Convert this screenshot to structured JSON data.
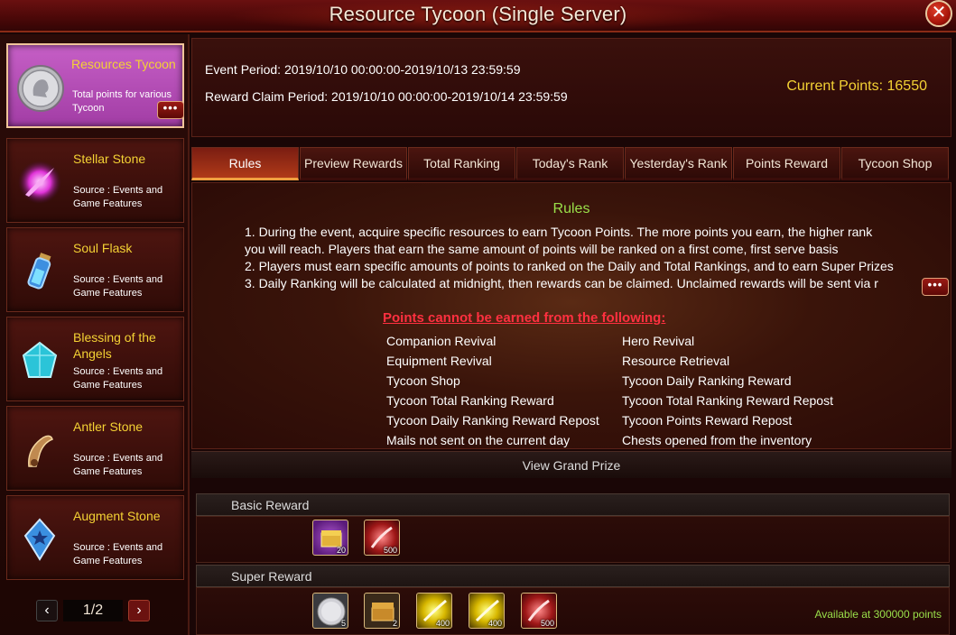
{
  "window": {
    "title": "Resource Tycoon (Single Server)"
  },
  "sidebar": {
    "items": [
      {
        "title": "Resources Tycoon",
        "desc": "Total points for various Tycoon",
        "icon": "silver-coin-icon",
        "active": true
      },
      {
        "title": "Stellar Stone",
        "desc": "Source : Events and Game Features",
        "icon": "stellar-stone-icon"
      },
      {
        "title": "Soul Flask",
        "desc": "Source : Events and Game Features",
        "icon": "soul-flask-icon"
      },
      {
        "title": "Blessing of the Angels",
        "desc": "Source : Events and Game Features",
        "icon": "cyan-crystal-icon"
      },
      {
        "title": "Antler Stone",
        "desc": "Source : Events and Game Features",
        "icon": "antler-stone-icon"
      },
      {
        "title": "Augment Stone",
        "desc": "Source : Events and Game Features",
        "icon": "augment-stone-icon"
      }
    ],
    "more_label": "•••",
    "pager": {
      "prev": "‹",
      "page": "1/2",
      "next": "›"
    }
  },
  "info": {
    "event_period": "Event Period: 2019/10/10 00:00:00-2019/10/13 23:59:59",
    "claim_period": "Reward Claim Period: 2019/10/10 00:00:00-2019/10/14 23:59:59",
    "current_points": "Current Points: 16550"
  },
  "tabs": [
    "Rules",
    "Preview Rewards",
    "Total Ranking",
    "Today's Rank",
    "Yesterday's Rank",
    "Points Reward",
    "Tycoon Shop"
  ],
  "rules": {
    "heading": "Rules",
    "lines": [
      "1. During the event, acquire specific resources to earn Tycoon Points. The more points you earn, the higher rank",
      "you will reach. Players that earn the same amount of points will be ranked on a first come, first serve basis",
      "2. Players must earn specific amounts of points to ranked on the Daily and Total Rankings, and to earn Super Prizes",
      "3. Daily Ranking will be calculated at midnight, then rewards can be claimed. Unclaimed rewards will be sent via r"
    ],
    "more_label": "•••",
    "warning": "Points cannot be earned from the following:",
    "exclusions_left": [
      "Companion Revival",
      "Equipment Revival",
      "Tycoon Shop",
      "Tycoon Total Ranking Reward",
      "Tycoon Daily Ranking Reward Repost",
      "Mails not sent on the current day"
    ],
    "exclusions_right": [
      "Hero Revival",
      "Resource Retrieval",
      "Tycoon Daily Ranking Reward",
      "Tycoon Total Ranking Reward Repost",
      "Tycoon Points Reward Repost",
      "Chests opened from the inventory"
    ]
  },
  "grand_prize": "View Grand Prize",
  "basic_reward": {
    "label": "Basic Reward",
    "items": [
      {
        "icon": "gold-chest-icon",
        "qty": "20"
      },
      {
        "icon": "red-gem-icon",
        "qty": "500"
      }
    ]
  },
  "super_reward": {
    "label": "Super Reward",
    "items": [
      {
        "icon": "silver-coin-icon",
        "qty": "5"
      },
      {
        "icon": "treasure-chest-icon",
        "qty": "2"
      },
      {
        "icon": "gold-sparkle-icon",
        "qty": "400"
      },
      {
        "icon": "gold-sparkle-icon",
        "qty": "400"
      },
      {
        "icon": "red-gem-icon",
        "qty": "500"
      }
    ],
    "availability": "Available at 300000 points"
  },
  "colors": {
    "accent_yellow": "#f4d234",
    "accent_green": "#9ae04a",
    "warning_red": "#ff3040"
  }
}
